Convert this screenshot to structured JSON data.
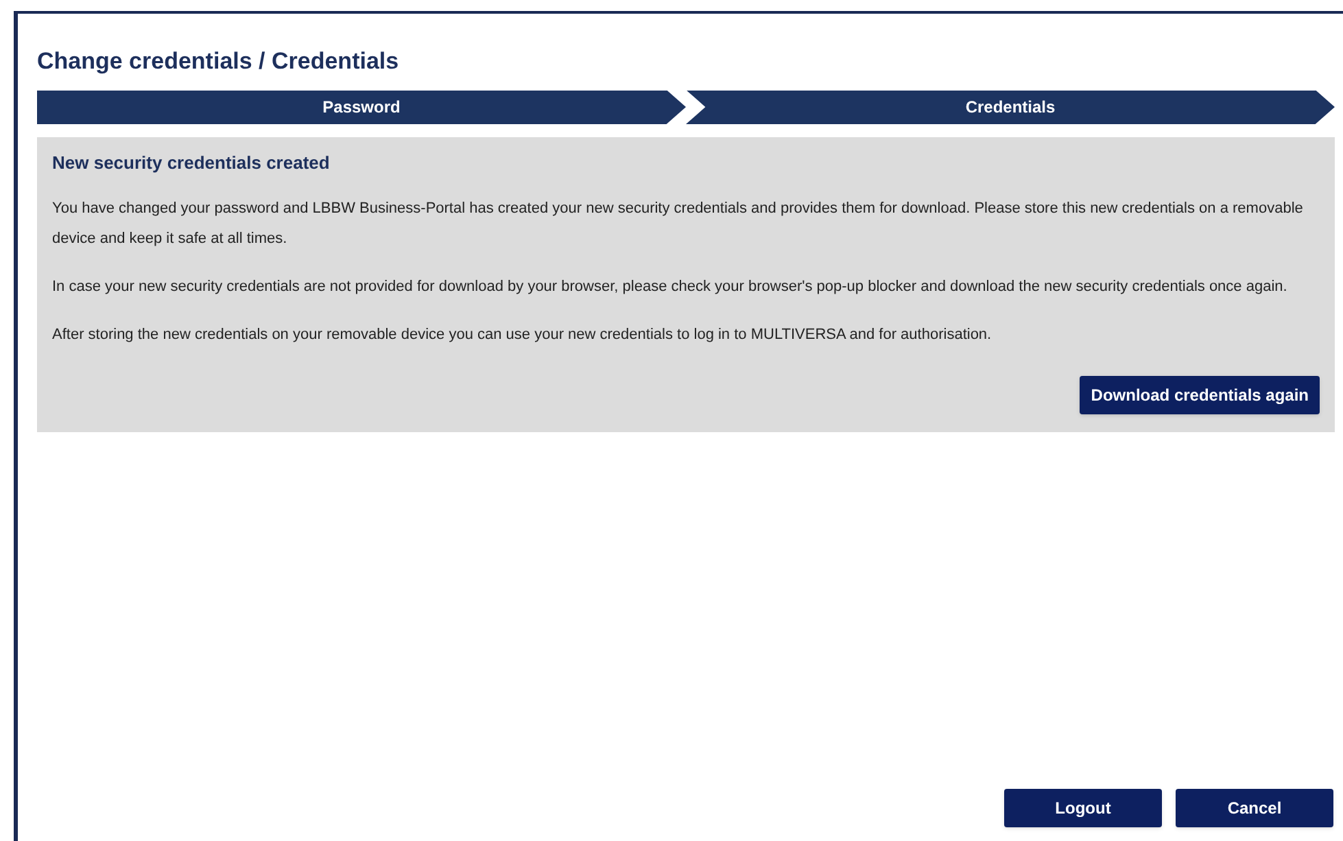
{
  "window": {
    "title": "Change credentials / Credentials"
  },
  "steps": [
    {
      "label": "Password"
    },
    {
      "label": "Credentials"
    }
  ],
  "panel": {
    "heading": "New security credentials created",
    "paragraphs": [
      "You have changed your password and LBBW Business-Portal has created your new security credentials and provides them for download. Please store this new credentials on a removable device and keep it safe at all times.",
      "In case your new security credentials are not provided for download by your browser, please check your browser's pop-up blocker and download the new security credentials once again.",
      "After storing the new credentials on your removable device you can use your new credentials to log in to MULTIVERSA and for authorisation."
    ],
    "button": "Download credentials again"
  },
  "buttons": [
    "Logout",
    "Cancel"
  ]
}
